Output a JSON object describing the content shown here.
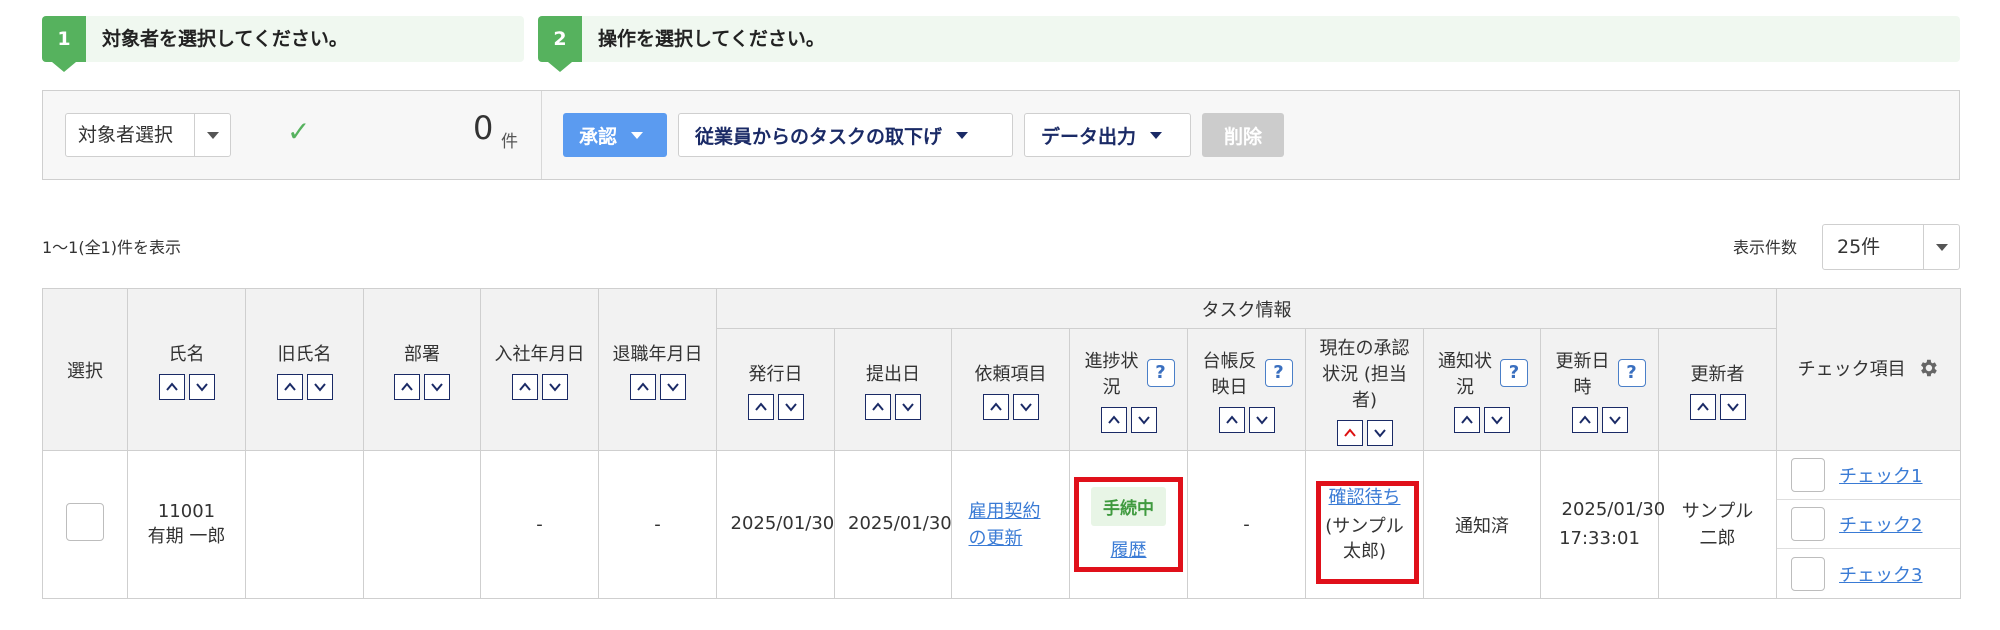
{
  "steps": [
    {
      "number": "1",
      "text": "対象者を選択してください。"
    },
    {
      "number": "2",
      "text": "操作を選択してください。"
    }
  ],
  "panel": {
    "target_select_label": "対象者選択",
    "count": "0",
    "count_unit": "件",
    "approve_label": "承認",
    "withdraw_label": "従業員からのタスクの取下げ",
    "export_label": "データ出力",
    "delete_label": "削除"
  },
  "results": {
    "info": "1〜1(全1)件を表示",
    "per_page_label": "表示件数",
    "per_page_value": "25件"
  },
  "table": {
    "group_header": "タスク情報",
    "columns": {
      "select": "選択",
      "name": "氏名",
      "old_name": "旧氏名",
      "department": "部署",
      "hire_date": "入社年月日",
      "retire_date": "退職年月日",
      "issue_date": "発行日",
      "submit_date": "提出日",
      "request_item": "依頼項目",
      "progress": "進捗状況",
      "ledger_date": "台帳反映日",
      "approval_status": "現在の承認状況 (担当者)",
      "notify_status": "通知状況",
      "updated_at": "更新日時",
      "updater": "更新者",
      "check_items": "チェック項目"
    },
    "row": {
      "employee_id": "11001",
      "employee_name": "有期 一郎",
      "old_name": "",
      "department": "",
      "hire_date": "-",
      "retire_date": "-",
      "issue_date": "2025/01/30",
      "submit_date": "2025/01/30",
      "request_item": "雇用契約の更新",
      "progress_badge": "手続中",
      "progress_link": "履歴",
      "ledger_date": "-",
      "approval_link": "確認待ち",
      "approval_person": "(サンプル太郎)",
      "notify_status": "通知済",
      "updated_date": "2025/01/30",
      "updated_time": "17:33:01",
      "updater": "サンプル二郎",
      "checks": [
        "チェック1",
        "チェック2",
        "チェック3"
      ]
    }
  },
  "colors": {
    "step_green": "#56b25e",
    "approve_blue": "#5b9bf0",
    "highlight_red": "#e0101a",
    "link_blue": "#3a7bd5"
  }
}
